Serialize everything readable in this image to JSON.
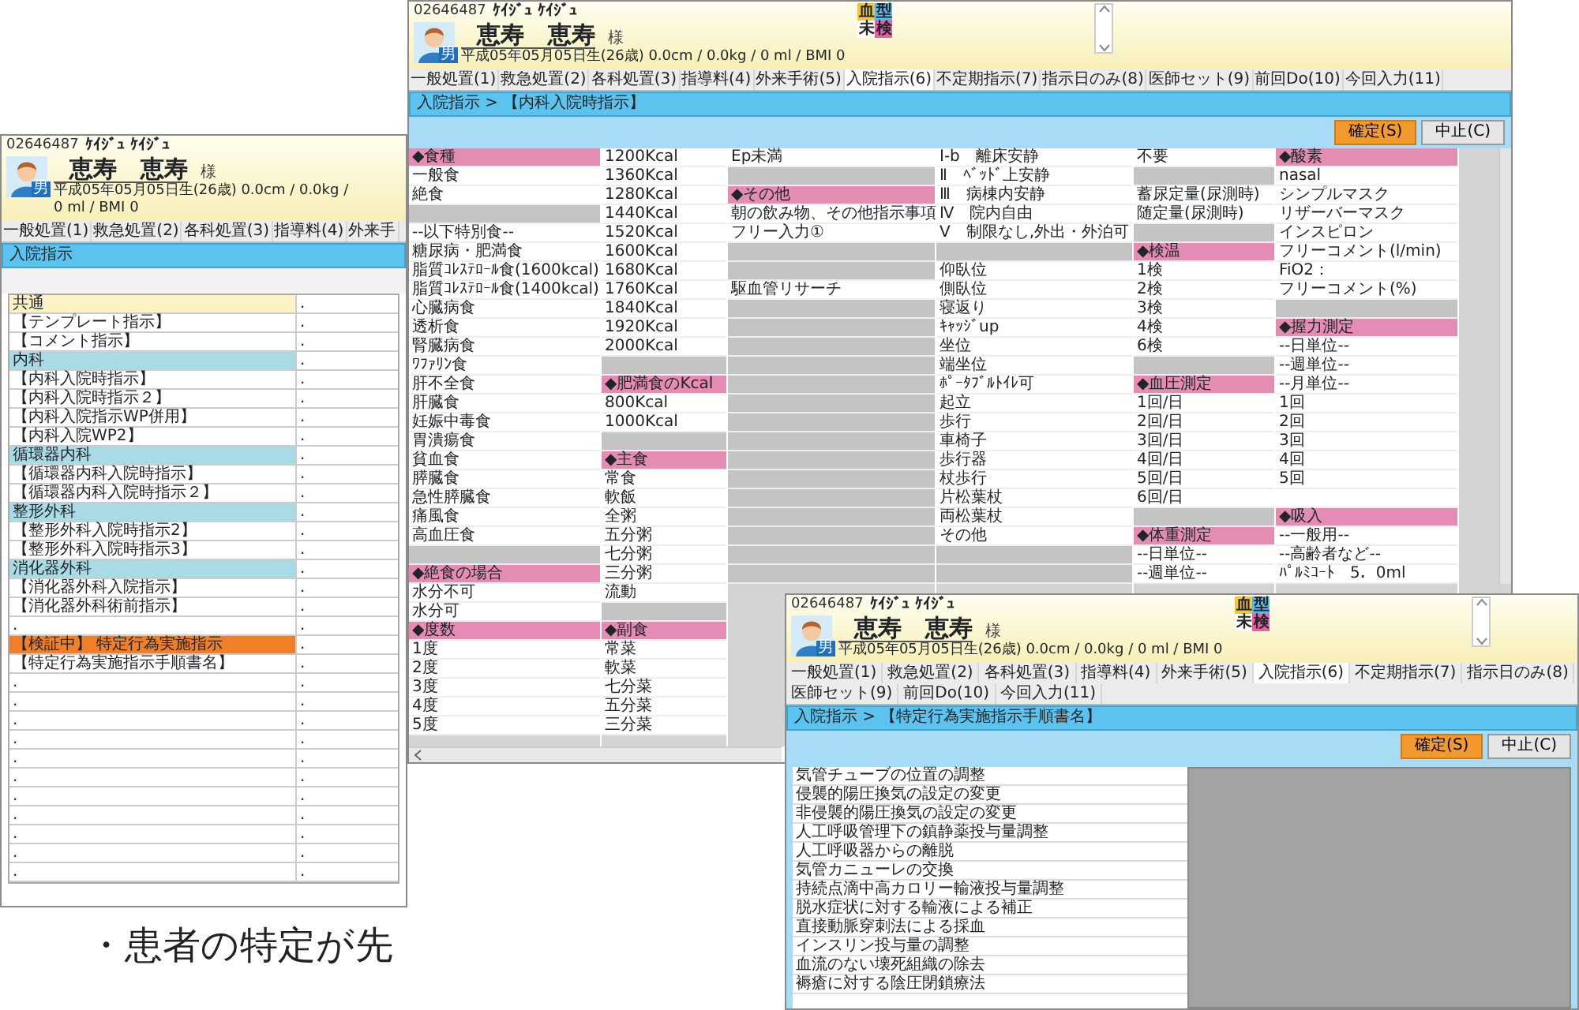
{
  "caption": "・患者の特定が先",
  "windows": [
    {
      "kind": "list-table",
      "patient": {
        "id": "02646487",
        "kana": "ｹｲｼﾞｭ ｹｲｼﾞｭ",
        "name": "恵寿　恵寿",
        "honorific": "様",
        "sex": "男",
        "info": "平成05年05月05日生(26歳)  0.0cm / 0.0kg / 0 ml / BMI 0"
      },
      "tabs": [
        {
          "label": "一般処置(1)",
          "selected": false
        },
        {
          "label": "救急処置(2)",
          "selected": false
        },
        {
          "label": "各科処置(3)",
          "selected": false
        },
        {
          "label": "指導料(4)",
          "selected": false
        },
        {
          "label": "外来手",
          "selected": false
        }
      ],
      "breadcrumb": "入院指示",
      "rows": [
        {
          "label": "共通",
          "value": ".",
          "color": "#fbf3c6"
        },
        {
          "label": "【テンプレート指示】",
          "value": "."
        },
        {
          "label": "【コメント指示】",
          "value": "."
        },
        {
          "label": "内科",
          "value": ".",
          "color": "#a9dbe5"
        },
        {
          "label": "【内科入院時指示】",
          "value": "."
        },
        {
          "label": "【内科入院時指示２】",
          "value": "."
        },
        {
          "label": "【内科入院指示WP併用】",
          "value": "."
        },
        {
          "label": "【内科入院WP2】",
          "value": "."
        },
        {
          "label": "循環器内科",
          "value": ".",
          "color": "#a9dbe5"
        },
        {
          "label": "【循環器内科入院時指示】",
          "value": "."
        },
        {
          "label": "【循環器内科入院時指示２】",
          "value": "."
        },
        {
          "label": "整形外科",
          "value": ".",
          "color": "#a9dbe5"
        },
        {
          "label": "【整形外科入院時指示2】",
          "value": "."
        },
        {
          "label": "【整形外科入院時指示3】",
          "value": "."
        },
        {
          "label": "消化器外科",
          "value": ".",
          "color": "#a9dbe5"
        },
        {
          "label": "【消化器外科入院指示】",
          "value": "."
        },
        {
          "label": "【消化器外科術前指示】",
          "value": "."
        },
        {
          "label": ".",
          "value": "."
        },
        {
          "label": "【検証中】 特定行為実施指示",
          "value": ".",
          "color": "#f07f2a"
        },
        {
          "label": "【特定行為実施指示手順書名】",
          "value": "."
        },
        {
          "label": ".",
          "value": "."
        },
        {
          "label": ".",
          "value": "."
        },
        {
          "label": ".",
          "value": "."
        },
        {
          "label": ".",
          "value": "."
        },
        {
          "label": ".",
          "value": "."
        },
        {
          "label": ".",
          "value": "."
        },
        {
          "label": ".",
          "value": "."
        },
        {
          "label": ".",
          "value": "."
        },
        {
          "label": ".",
          "value": "."
        },
        {
          "label": ".",
          "value": "."
        },
        {
          "label": ".",
          "value": "."
        }
      ]
    },
    {
      "kind": "grid",
      "patient": {
        "id": "02646487",
        "kana": "ｹｲｼﾞｭ ｹｲｼﾞｭ",
        "name": "恵寿　恵寿",
        "honorific": "様",
        "sex": "男",
        "info": "平成05年05月05日生(26歳)  0.0cm / 0.0kg / 0 ml / BMI 0"
      },
      "badge": [
        {
          "label": "血",
          "color": "#f2c53d"
        },
        {
          "label": "型",
          "color": "#5bb8e8"
        },
        {
          "label": "未",
          "color": "#ffffff"
        },
        {
          "label": "検",
          "color": "#e85fa6"
        }
      ],
      "tabs": [
        {
          "label": "一般処置(1)",
          "selected": false
        },
        {
          "label": "救急処置(2)",
          "selected": false
        },
        {
          "label": "各科処置(3)",
          "selected": false
        },
        {
          "label": "指導料(4)",
          "selected": false
        },
        {
          "label": "外来手術(5)",
          "selected": false
        },
        {
          "label": "入院指示(6)",
          "selected": true
        },
        {
          "label": "不定期指示(7)",
          "selected": false
        },
        {
          "label": "指示日のみ(8)",
          "selected": false
        },
        {
          "label": "医師セット(9)",
          "selected": false
        },
        {
          "label": "前回Do(10)",
          "selected": false
        },
        {
          "label": "今回入力(11)",
          "selected": false
        }
      ],
      "breadcrumb": "入院指示 >  【内科入院時指示】",
      "buttons": [
        {
          "label": "確定(S)",
          "kind": "primary"
        },
        {
          "label": "中止(C)",
          "kind": "secondary"
        }
      ],
      "columns": [
        {
          "cells": [
            {
              "kind": "header",
              "text": "◆食種"
            },
            {
              "kind": "item",
              "text": "一般食"
            },
            {
              "kind": "item",
              "text": "絶食"
            },
            {
              "kind": "blank"
            },
            {
              "kind": "item",
              "text": "--以下特別食--"
            },
            {
              "kind": "item",
              "text": "糖尿病・肥満食"
            },
            {
              "kind": "item",
              "text": "脂質ｺﾚｽﾃﾛｰﾙ食(1600kcal)"
            },
            {
              "kind": "item",
              "text": "脂質ｺﾚｽﾃﾛｰﾙ食(1400kcal)"
            },
            {
              "kind": "item",
              "text": "心臓病食"
            },
            {
              "kind": "item",
              "text": "透析食"
            },
            {
              "kind": "item",
              "text": "腎臓病食"
            },
            {
              "kind": "item",
              "text": "ﾜﾌｧﾘﾝ食"
            },
            {
              "kind": "item",
              "text": "肝不全食"
            },
            {
              "kind": "item",
              "text": "肝臓食"
            },
            {
              "kind": "item",
              "text": "妊娠中毒食"
            },
            {
              "kind": "item",
              "text": "胃潰瘍食"
            },
            {
              "kind": "item",
              "text": "貧血食"
            },
            {
              "kind": "item",
              "text": "膵臓食"
            },
            {
              "kind": "item",
              "text": "急性膵臓食"
            },
            {
              "kind": "item",
              "text": "痛風食"
            },
            {
              "kind": "item",
              "text": "高血圧食"
            },
            {
              "kind": "blank"
            },
            {
              "kind": "header",
              "text": "◆絶食の場合"
            },
            {
              "kind": "item",
              "text": "水分不可"
            },
            {
              "kind": "item",
              "text": "水分可"
            },
            {
              "kind": "header",
              "text": "◆度数"
            },
            {
              "kind": "item",
              "text": "1度"
            },
            {
              "kind": "item",
              "text": "2度"
            },
            {
              "kind": "item",
              "text": "3度"
            },
            {
              "kind": "item",
              "text": "4度"
            },
            {
              "kind": "item",
              "text": "5度"
            }
          ]
        },
        {
          "cells": [
            {
              "kind": "item",
              "text": "1200Kcal"
            },
            {
              "kind": "item",
              "text": "1360Kcal"
            },
            {
              "kind": "item",
              "text": "1280Kcal"
            },
            {
              "kind": "item",
              "text": "1440Kcal"
            },
            {
              "kind": "item",
              "text": "1520Kcal"
            },
            {
              "kind": "item",
              "text": "1600Kcal"
            },
            {
              "kind": "item",
              "text": "1680Kcal"
            },
            {
              "kind": "item",
              "text": "1760Kcal"
            },
            {
              "kind": "item",
              "text": "1840Kcal"
            },
            {
              "kind": "item",
              "text": "1920Kcal"
            },
            {
              "kind": "item",
              "text": "2000Kcal"
            },
            {
              "kind": "blank"
            },
            {
              "kind": "header",
              "text": "◆肥満食のKcal"
            },
            {
              "kind": "item",
              "text": "800Kcal"
            },
            {
              "kind": "item",
              "text": "1000Kcal"
            },
            {
              "kind": "blank"
            },
            {
              "kind": "header",
              "text": "◆主食"
            },
            {
              "kind": "item",
              "text": "常食"
            },
            {
              "kind": "item",
              "text": "軟飯"
            },
            {
              "kind": "item",
              "text": "全粥"
            },
            {
              "kind": "item",
              "text": "五分粥"
            },
            {
              "kind": "item",
              "text": "七分粥"
            },
            {
              "kind": "item",
              "text": "三分粥"
            },
            {
              "kind": "item",
              "text": "流動"
            },
            {
              "kind": "blank"
            },
            {
              "kind": "header",
              "text": "◆副食"
            },
            {
              "kind": "item",
              "text": "常菜"
            },
            {
              "kind": "item",
              "text": "軟菜"
            },
            {
              "kind": "item",
              "text": "七分菜"
            },
            {
              "kind": "item",
              "text": "五分菜"
            },
            {
              "kind": "item",
              "text": "三分菜"
            }
          ]
        },
        {
          "cells": [
            {
              "kind": "item",
              "text": "Ep未満"
            },
            {
              "kind": "blank"
            },
            {
              "kind": "header",
              "text": "◆その他"
            },
            {
              "kind": "item",
              "text": "朝の飲み物、その他指示事項"
            },
            {
              "kind": "item",
              "text": "フリー入力①"
            },
            {
              "kind": "blank"
            },
            {
              "kind": "blank"
            },
            {
              "kind": "item",
              "text": "駆血管リサーチ"
            },
            {
              "kind": "blank"
            },
            {
              "kind": "blank"
            },
            {
              "kind": "blank"
            },
            {
              "kind": "blank"
            },
            {
              "kind": "blank"
            },
            {
              "kind": "blank"
            },
            {
              "kind": "blank"
            },
            {
              "kind": "blank"
            },
            {
              "kind": "blank"
            },
            {
              "kind": "blank"
            },
            {
              "kind": "blank"
            },
            {
              "kind": "blank"
            },
            {
              "kind": "blank"
            },
            {
              "kind": "blank"
            },
            {
              "kind": "blank"
            }
          ]
        },
        {
          "cells": [
            {
              "kind": "item",
              "text": "Ⅰ-b　離床安静"
            },
            {
              "kind": "item",
              "text": "Ⅱ　ﾍﾞｯﾄﾞ上安静"
            },
            {
              "kind": "item",
              "text": "Ⅲ　病棟内安静"
            },
            {
              "kind": "item",
              "text": "Ⅳ　院内自由"
            },
            {
              "kind": "item",
              "text": "Ⅴ　制限なし,外出・外泊可"
            },
            {
              "kind": "blank"
            },
            {
              "kind": "item",
              "text": "仰臥位"
            },
            {
              "kind": "item",
              "text": "側臥位"
            },
            {
              "kind": "item",
              "text": "寝返り"
            },
            {
              "kind": "item",
              "text": "ｷｬｯｼﾞup"
            },
            {
              "kind": "item",
              "text": "坐位"
            },
            {
              "kind": "item",
              "text": "端坐位"
            },
            {
              "kind": "item",
              "text": "ﾎﾟｰﾀﾌﾞﾙﾄｲﾚ可"
            },
            {
              "kind": "item",
              "text": "起立"
            },
            {
              "kind": "item",
              "text": "歩行"
            },
            {
              "kind": "item",
              "text": "車椅子"
            },
            {
              "kind": "item",
              "text": "歩行器"
            },
            {
              "kind": "item",
              "text": "杖歩行"
            },
            {
              "kind": "item",
              "text": "片松葉杖"
            },
            {
              "kind": "item",
              "text": "両松葉杖"
            },
            {
              "kind": "item",
              "text": "その他"
            },
            {
              "kind": "blank"
            },
            {
              "kind": "blank"
            }
          ]
        },
        {
          "cells": [
            {
              "kind": "item",
              "text": "不要"
            },
            {
              "kind": "blank"
            },
            {
              "kind": "item",
              "text": "蓄尿定量(尿測時)"
            },
            {
              "kind": "item",
              "text": "随定量(尿測時)"
            },
            {
              "kind": "blank"
            },
            {
              "kind": "header",
              "text": "◆検温"
            },
            {
              "kind": "item",
              "text": "1検"
            },
            {
              "kind": "item",
              "text": "2検"
            },
            {
              "kind": "item",
              "text": "3検"
            },
            {
              "kind": "item",
              "text": "4検"
            },
            {
              "kind": "item",
              "text": "6検"
            },
            {
              "kind": "blank"
            },
            {
              "kind": "header",
              "text": "◆血圧測定"
            },
            {
              "kind": "item",
              "text": "1回/日"
            },
            {
              "kind": "item",
              "text": "2回/日"
            },
            {
              "kind": "item",
              "text": "3回/日"
            },
            {
              "kind": "item",
              "text": "4回/日"
            },
            {
              "kind": "item",
              "text": "5回/日"
            },
            {
              "kind": "item",
              "text": "6回/日"
            },
            {
              "kind": "blank"
            },
            {
              "kind": "header",
              "text": "◆体重測定"
            },
            {
              "kind": "item",
              "text": "--日単位--"
            },
            {
              "kind": "item",
              "text": "--週単位--"
            }
          ]
        },
        {
          "cells": [
            {
              "kind": "header",
              "text": "◆酸素"
            },
            {
              "kind": "item",
              "text": "nasal"
            },
            {
              "kind": "item",
              "text": "シンプルマスク"
            },
            {
              "kind": "item",
              "text": "リザーバーマスク"
            },
            {
              "kind": "item",
              "text": "インスピロン"
            },
            {
              "kind": "item",
              "text": "フリーコメント(l/min)"
            },
            {
              "kind": "item",
              "text": "FiO2："
            },
            {
              "kind": "item",
              "text": "フリーコメント(%)"
            },
            {
              "kind": "blank"
            },
            {
              "kind": "header",
              "text": "◆握力測定"
            },
            {
              "kind": "item",
              "text": "--日単位--"
            },
            {
              "kind": "item",
              "text": "--週単位--"
            },
            {
              "kind": "item",
              "text": "--月単位--"
            },
            {
              "kind": "item",
              "text": "1回"
            },
            {
              "kind": "item",
              "text": "2回"
            },
            {
              "kind": "item",
              "text": "3回"
            },
            {
              "kind": "item",
              "text": "4回"
            },
            {
              "kind": "item",
              "text": "5回"
            },
            {
              "kind": "empty"
            },
            {
              "kind": "header",
              "text": "◆吸入"
            },
            {
              "kind": "item",
              "text": "--一般用--"
            },
            {
              "kind": "item",
              "text": "--高齢者など--"
            },
            {
              "kind": "item",
              "text": "ﾊﾟﾙﾐｺｰﾄ　5．0ml"
            }
          ]
        }
      ]
    },
    {
      "kind": "list",
      "patient": {
        "id": "02646487",
        "kana": "ｹｲｼﾞｭ ｹｲｼﾞｭ",
        "name": "恵寿　恵寿",
        "honorific": "様",
        "sex": "男",
        "info": "平成05年05月05日生(26歳)  0.0cm / 0.0kg / 0 ml / BMI 0"
      },
      "badge": [
        {
          "label": "血",
          "color": "#f2c53d"
        },
        {
          "label": "型",
          "color": "#5bb8e8"
        },
        {
          "label": "未",
          "color": "#ffffff"
        },
        {
          "label": "検",
          "color": "#e85fa6"
        }
      ],
      "tabs": [
        {
          "label": "一般処置(1)",
          "selected": false
        },
        {
          "label": "救急処置(2)",
          "selected": false
        },
        {
          "label": "各科処置(3)",
          "selected": false
        },
        {
          "label": "指導料(4)",
          "selected": false
        },
        {
          "label": "外来手術(5)",
          "selected": false
        },
        {
          "label": "入院指示(6)",
          "selected": true
        },
        {
          "label": "不定期指示(7)",
          "selected": false
        },
        {
          "label": "指示日のみ(8)",
          "selected": false
        },
        {
          "label": "医師セット(9)",
          "selected": false
        },
        {
          "label": "前回Do(10)",
          "selected": false
        },
        {
          "label": "今回入力(11)",
          "selected": false
        }
      ],
      "breadcrumb": "入院指示 >  【特定行為実施指示手順書名】",
      "buttons": [
        {
          "label": "確定(S)",
          "kind": "primary"
        },
        {
          "label": "中止(C)",
          "kind": "secondary"
        }
      ],
      "items": [
        "気管チューブの位置の調整",
        "侵襲的陽圧換気の設定の変更",
        "非侵襲的陽圧換気の設定の変更",
        "人工呼吸管理下の鎮静薬投与量調整",
        "人工呼吸器からの離脱",
        "気管カニューレの交換",
        "持続点滴中高カロリー輸液投与量調整",
        "脱水症状に対する輸液による補正",
        "直接動脈穿刺法による採血",
        "インスリン投与量の調整",
        "血流のない壊死組織の除去",
        "褥瘡に対する陰圧閉鎖療法"
      ]
    }
  ]
}
